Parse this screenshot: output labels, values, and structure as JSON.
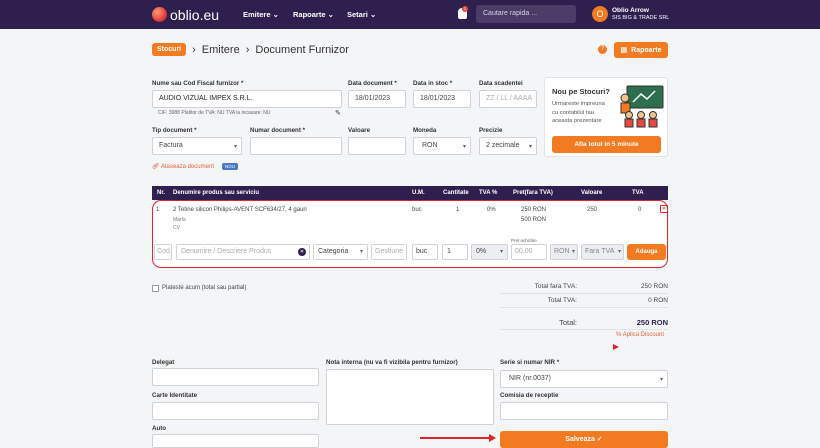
{
  "topbar": {
    "logo_text": "oblio.eu",
    "nav": [
      "Emitere",
      "Rapoarte",
      "Setari"
    ],
    "notifications": "1",
    "search_placeholder": "Cautare rapida ...",
    "user_initial": "O",
    "user_name": "Oblio Arrow",
    "company": "SIS BIG & TRADE SRL"
  },
  "breadcrumb": {
    "stoc": "Stocuri",
    "emitere": "Emitere",
    "doc": "Document Furnizor"
  },
  "reports_button": "Rapoarte",
  "form": {
    "furnizor_label": "Nume sau Cod Fiscal furnizor *",
    "furnizor_value": "AUDIO VIZUAL IMPEX S.R.L.",
    "cif_info": "CIF: 3988   Platitor de TVA: NU   TVA la incasare: NU",
    "data_doc_label": "Data document *",
    "data_doc_value": "18/01/2023",
    "data_stoc_label": "Data in stoc *",
    "data_stoc_value": "18/01/2023",
    "data_scad_label": "Data scadentei",
    "data_scad_placeholder": "ZZ / LL / AAAA",
    "tip_label": "Tip document *",
    "tip_value": "Factura",
    "numar_label": "Numar document *",
    "valoare_label": "Valoare",
    "moneda_label": "Moneda",
    "moneda_value": "RON",
    "precizie_label": "Precizie",
    "precizie_value": "2 zecimale",
    "attach_label": "Ataseaza document",
    "attach_badge": "NOU"
  },
  "promo": {
    "title": "Nou pe Stocuri?",
    "body": "Urmareste impreuna cu contabilul tau aceasta prezentare",
    "button": "Afla totul in 5 minute"
  },
  "table": {
    "headers": [
      "Nr.",
      "Denumire produs sau serviciu",
      "U.M.",
      "Cantitate",
      "TVA %",
      "Pret(fara TVA)",
      "Valoare",
      "TVA"
    ],
    "row": {
      "nr": "1",
      "name": "2 Tetine silicon Philips-AVENT SCF634/27, 4 gauri",
      "gest": "Marfa",
      "cat": "CV",
      "um": "buc",
      "qty": "1",
      "tva": "0%",
      "price": "250 RON",
      "price2": "500 RON",
      "valoare": "250",
      "tva_val": "0"
    },
    "add_row": {
      "cod_placeholder": "Cod",
      "den_placeholder": "Denumire / Descriere Produs",
      "categoria": "Categoria",
      "gestiune_placeholder": "Gestiune",
      "um": "buc",
      "qty": "1",
      "tva": "0%",
      "pret_label": "Pret achizitie",
      "pret_placeholder": "00.00",
      "moneda": "RON",
      "tva_opt": "Fara TVA",
      "button": "Adauga"
    }
  },
  "payment_check": "Plateste acum (total sau partial)",
  "totals": {
    "fara_tva_label": "Total fara TVA:",
    "fara_tva": "250 RON",
    "tva_label": "Total TVA:",
    "tva": "0 RON",
    "total_label": "Total:",
    "total": "250 RON",
    "discount": "% Aplica Discount"
  },
  "bottom": {
    "delegat": "Delegat",
    "carte": "Carte Identitate",
    "auto": "Auto",
    "nota": "Nota interna (nu va fi vizibila pentru furnizor)",
    "serie_label": "Serie si numar NIR *",
    "serie_value": "NIR (nr.0037)",
    "comisia": "Comisia de receptie",
    "save": "Salveaza ✓"
  },
  "colors": {
    "accent": "#f27a20",
    "topbar": "#2e1f4f",
    "highlight": "#e0242c"
  }
}
